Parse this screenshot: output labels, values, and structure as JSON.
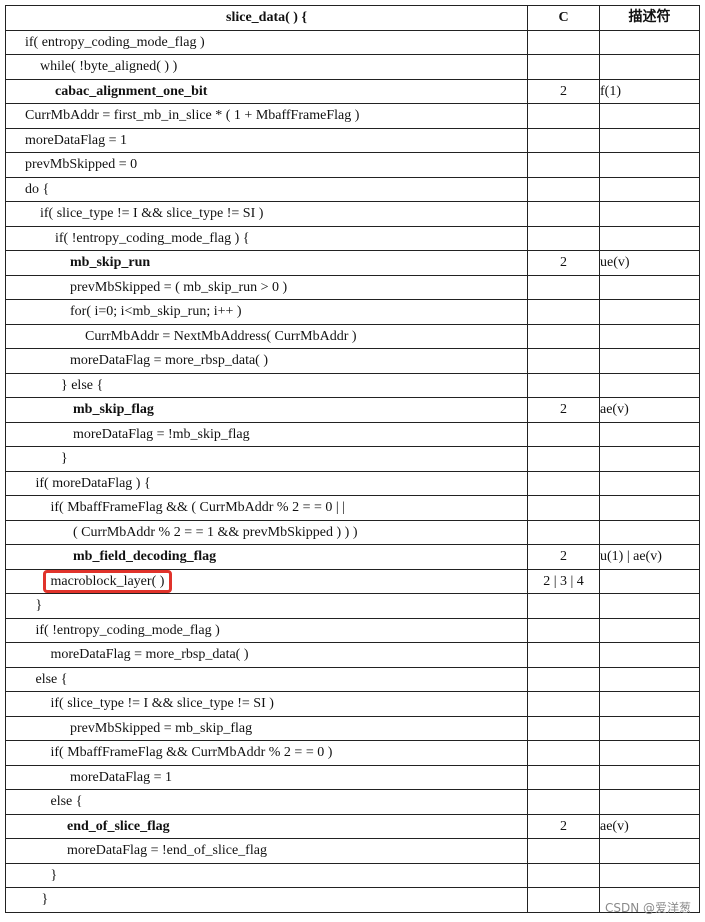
{
  "header": {
    "syntax": "slice_data( ) {",
    "category": "C",
    "descriptor": "描述符"
  },
  "rows": [
    {
      "indent": 0,
      "text": "if( entropy_coding_mode_flag )",
      "bold": false,
      "c": "",
      "d": ""
    },
    {
      "indent": 1,
      "text": "while( !byte_aligned( ) )",
      "bold": false,
      "c": "",
      "d": ""
    },
    {
      "indent": 2,
      "text": "cabac_alignment_one_bit",
      "bold": true,
      "c": "2",
      "d": "f(1)"
    },
    {
      "indent": 0,
      "text": "CurrMbAddr = first_mb_in_slice * ( 1 + MbaffFrameFlag )",
      "bold": false,
      "c": "",
      "d": ""
    },
    {
      "indent": 0,
      "text": "moreDataFlag = 1",
      "bold": false,
      "c": "",
      "d": ""
    },
    {
      "indent": 0,
      "text": "prevMbSkipped = 0",
      "bold": false,
      "c": "",
      "d": ""
    },
    {
      "indent": 0,
      "text": "do {",
      "bold": false,
      "c": "",
      "d": ""
    },
    {
      "indent": 1,
      "text": "if( slice_type  !=  I  &&  slice_type  !=  SI )",
      "bold": false,
      "c": "",
      "d": ""
    },
    {
      "indent": 2,
      "text": "if( !entropy_coding_mode_flag ) {",
      "bold": false,
      "c": "",
      "d": ""
    },
    {
      "indent": 3,
      "text": "mb_skip_run",
      "bold": true,
      "c": "2",
      "d": "ue(v)"
    },
    {
      "indent": 3,
      "text": "prevMbSkipped = ( mb_skip_run > 0 )",
      "bold": false,
      "c": "",
      "d": ""
    },
    {
      "indent": 3,
      "text": "for(  i=0;  i<mb_skip_run;  i++ )",
      "bold": false,
      "c": "",
      "d": ""
    },
    {
      "indent": 4,
      "text": "CurrMbAddr = NextMbAddress( CurrMbAddr )",
      "bold": false,
      "c": "",
      "d": ""
    },
    {
      "indent": 3,
      "text": "moreDataFlag = more_rbsp_data( )",
      "bold": false,
      "c": "",
      "d": ""
    },
    {
      "indent": 2.4,
      "text": "} else {",
      "bold": false,
      "c": "",
      "d": ""
    },
    {
      "indent": 3.2,
      "text": "mb_skip_flag",
      "bold": true,
      "c": "2",
      "d": "ae(v)"
    },
    {
      "indent": 3.2,
      "text": "moreDataFlag = !mb_skip_flag",
      "bold": false,
      "c": "",
      "d": ""
    },
    {
      "indent": 2.4,
      "text": "}",
      "bold": false,
      "c": "",
      "d": ""
    },
    {
      "indent": 0.7,
      "text": "if( moreDataFlag ) {",
      "bold": false,
      "c": "",
      "d": ""
    },
    {
      "indent": 1.7,
      "text": "if( MbaffFrameFlag && ( CurrMbAddr % 2  = =  0  | |",
      "bold": false,
      "c": "",
      "d": ""
    },
    {
      "indent": 3.2,
      "text": "( CurrMbAddr % 2  = =  1  &&  prevMbSkipped ) ) )",
      "bold": false,
      "c": "",
      "d": ""
    },
    {
      "indent": 3.2,
      "text": "mb_field_decoding_flag",
      "bold": true,
      "c": "2",
      "d": "u(1) | ae(v)"
    },
    {
      "indent": 1.7,
      "text": "macroblock_layer( )",
      "bold": false,
      "c": "2 | 3 | 4",
      "d": "",
      "highlight": true
    },
    {
      "indent": 0.7,
      "text": "}",
      "bold": false,
      "c": "",
      "d": ""
    },
    {
      "indent": 0.7,
      "text": "if( !entropy_coding_mode_flag )",
      "bold": false,
      "c": "",
      "d": ""
    },
    {
      "indent": 1.7,
      "text": "moreDataFlag = more_rbsp_data( )",
      "bold": false,
      "c": "",
      "d": ""
    },
    {
      "indent": 0.7,
      "text": "else {",
      "bold": false,
      "c": "",
      "d": ""
    },
    {
      "indent": 1.7,
      "text": "if( slice_type  !=  I  &&  slice_type  !=  SI )",
      "bold": false,
      "c": "",
      "d": ""
    },
    {
      "indent": 3.0,
      "text": "prevMbSkipped = mb_skip_flag",
      "bold": false,
      "c": "",
      "d": ""
    },
    {
      "indent": 1.7,
      "text": "if(  MbaffFrameFlag  &&  CurrMbAddr % 2  = =  0 )",
      "bold": false,
      "c": "",
      "d": ""
    },
    {
      "indent": 3.0,
      "text": "moreDataFlag = 1",
      "bold": false,
      "c": "",
      "d": ""
    },
    {
      "indent": 1.7,
      "text": "else {",
      "bold": false,
      "c": "",
      "d": ""
    },
    {
      "indent": 2.8,
      "text": "end_of_slice_flag",
      "bold": true,
      "c": "2",
      "d": "ae(v)"
    },
    {
      "indent": 2.8,
      "text": "moreDataFlag = !end_of_slice_flag",
      "bold": false,
      "c": "",
      "d": ""
    },
    {
      "indent": 1.7,
      "text": "}",
      "bold": false,
      "c": "",
      "d": ""
    },
    {
      "indent": 1.1,
      "text": "}",
      "bold": false,
      "c": "",
      "d": ""
    }
  ],
  "watermark": "CSDN @爱洋葱"
}
